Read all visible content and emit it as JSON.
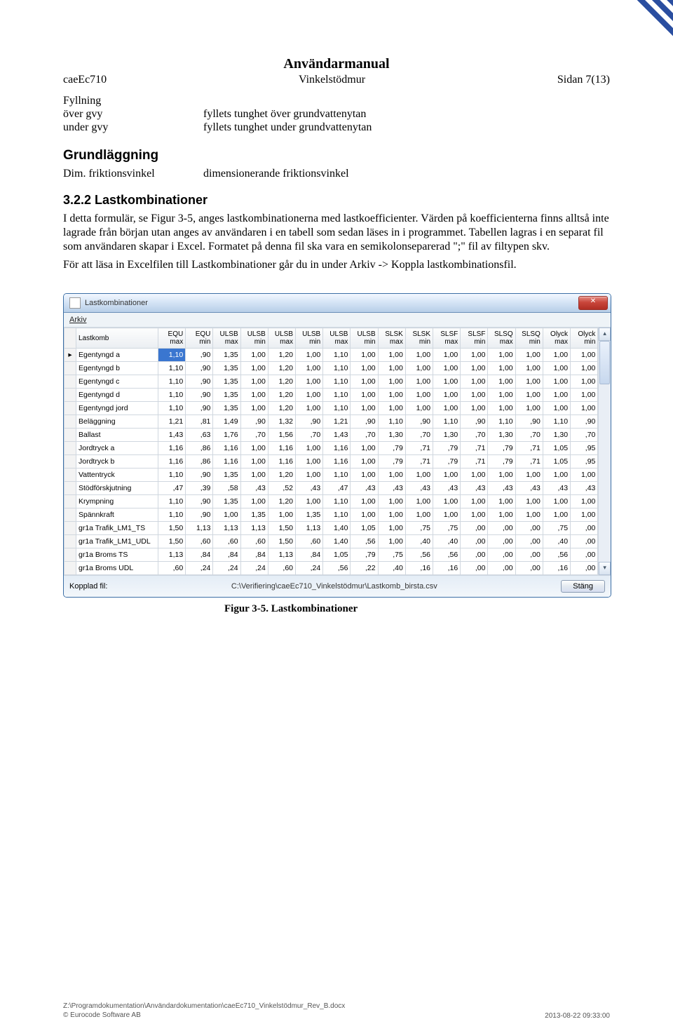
{
  "header": {
    "manual_title": "Användarmanual",
    "left": "caeEc710",
    "center": "Vinkelstödmur",
    "right": "Sidan 7(13)"
  },
  "fyllning": {
    "heading": "Fyllning",
    "rows": [
      {
        "label": "över gvy",
        "desc": "fyllets tunghet över grundvattenytan"
      },
      {
        "label": "under gvy",
        "desc": "fyllets tunghet under grundvattenytan"
      }
    ]
  },
  "grundlaggning": {
    "heading": "Grundläggning",
    "rows": [
      {
        "label": "Dim. friktionsvinkel",
        "desc": "dimensionerande friktionsvinkel"
      }
    ]
  },
  "section": {
    "num_title": "3.2.2 Lastkombinationer",
    "p1": "I detta formulär, se Figur 3-5, anges lastkombinationerna med lastkoefficienter. Värden på koefficienterna finns alltså inte lagrade från början utan anges av användaren i en tabell som sedan läses in i programmet. Tabellen lagras i en separat fil som användaren skapar i Excel. Formatet på denna fil ska vara en semikolonseparerad \";\" fil av filtypen skv.",
    "p2": "För att läsa in Excelfilen till Lastkombinationer går du in under Arkiv -> Koppla lastkombinationsfil."
  },
  "window": {
    "title": "Lastkombinationer",
    "menu": "Arkiv",
    "footer_label": "Kopplad fil:",
    "footer_path": "C:\\Verifiering\\caeEc710_Vinkelstödmur\\Lastkomb_birsta.csv",
    "close_button": "Stäng",
    "columns": [
      {
        "t1": "Lastkomb",
        "t2": ""
      },
      {
        "t1": "EQU",
        "t2": "max"
      },
      {
        "t1": "EQU",
        "t2": "min"
      },
      {
        "t1": "ULSB",
        "t2": "max"
      },
      {
        "t1": "ULSB",
        "t2": "min"
      },
      {
        "t1": "ULSB",
        "t2": "max"
      },
      {
        "t1": "ULSB",
        "t2": "min"
      },
      {
        "t1": "ULSB",
        "t2": "max"
      },
      {
        "t1": "ULSB",
        "t2": "min"
      },
      {
        "t1": "SLSK",
        "t2": "max"
      },
      {
        "t1": "SLSK",
        "t2": "min"
      },
      {
        "t1": "SLSF",
        "t2": "max"
      },
      {
        "t1": "SLSF",
        "t2": "min"
      },
      {
        "t1": "SLSQ",
        "t2": "max"
      },
      {
        "t1": "SLSQ",
        "t2": "min"
      },
      {
        "t1": "Olyck",
        "t2": "max"
      },
      {
        "t1": "Olyck",
        "t2": "min"
      }
    ],
    "rows": [
      {
        "name": "Egentyngd a",
        "v": [
          "1,10",
          ",90",
          "1,35",
          "1,00",
          "1,20",
          "1,00",
          "1,10",
          "1,00",
          "1,00",
          "1,00",
          "1,00",
          "1,00",
          "1,00",
          "1,00",
          "1,00",
          "1,00"
        ],
        "sel": true
      },
      {
        "name": "Egentyngd b",
        "v": [
          "1,10",
          ",90",
          "1,35",
          "1,00",
          "1,20",
          "1,00",
          "1,10",
          "1,00",
          "1,00",
          "1,00",
          "1,00",
          "1,00",
          "1,00",
          "1,00",
          "1,00",
          "1,00"
        ]
      },
      {
        "name": "Egentyngd c",
        "v": [
          "1,10",
          ",90",
          "1,35",
          "1,00",
          "1,20",
          "1,00",
          "1,10",
          "1,00",
          "1,00",
          "1,00",
          "1,00",
          "1,00",
          "1,00",
          "1,00",
          "1,00",
          "1,00"
        ]
      },
      {
        "name": "Egentyngd d",
        "v": [
          "1,10",
          ",90",
          "1,35",
          "1,00",
          "1,20",
          "1,00",
          "1,10",
          "1,00",
          "1,00",
          "1,00",
          "1,00",
          "1,00",
          "1,00",
          "1,00",
          "1,00",
          "1,00"
        ]
      },
      {
        "name": "Egentyngd jord",
        "v": [
          "1,10",
          ",90",
          "1,35",
          "1,00",
          "1,20",
          "1,00",
          "1,10",
          "1,00",
          "1,00",
          "1,00",
          "1,00",
          "1,00",
          "1,00",
          "1,00",
          "1,00",
          "1,00"
        ]
      },
      {
        "name": "Beläggning",
        "v": [
          "1,21",
          ",81",
          "1,49",
          ",90",
          "1,32",
          ",90",
          "1,21",
          ",90",
          "1,10",
          ",90",
          "1,10",
          ",90",
          "1,10",
          ",90",
          "1,10",
          ",90"
        ]
      },
      {
        "name": "Ballast",
        "v": [
          "1,43",
          ",63",
          "1,76",
          ",70",
          "1,56",
          ",70",
          "1,43",
          ",70",
          "1,30",
          ",70",
          "1,30",
          ",70",
          "1,30",
          ",70",
          "1,30",
          ",70"
        ]
      },
      {
        "name": "Jordtryck a",
        "v": [
          "1,16",
          ",86",
          "1,16",
          "1,00",
          "1,16",
          "1,00",
          "1,16",
          "1,00",
          ",79",
          ",71",
          ",79",
          ",71",
          ",79",
          ",71",
          "1,05",
          ",95"
        ]
      },
      {
        "name": "Jordtryck b",
        "v": [
          "1,16",
          ",86",
          "1,16",
          "1,00",
          "1,16",
          "1,00",
          "1,16",
          "1,00",
          ",79",
          ",71",
          ",79",
          ",71",
          ",79",
          ",71",
          "1,05",
          ",95"
        ]
      },
      {
        "name": "Vattentryck",
        "v": [
          "1,10",
          ",90",
          "1,35",
          "1,00",
          "1,20",
          "1,00",
          "1,10",
          "1,00",
          "1,00",
          "1,00",
          "1,00",
          "1,00",
          "1,00",
          "1,00",
          "1,00",
          "1,00"
        ]
      },
      {
        "name": "Stödförskjutning",
        "v": [
          ",47",
          ",39",
          ",58",
          ",43",
          ",52",
          ",43",
          ",47",
          ",43",
          ",43",
          ",43",
          ",43",
          ",43",
          ",43",
          ",43",
          ",43",
          ",43"
        ]
      },
      {
        "name": "Krympning",
        "v": [
          "1,10",
          ",90",
          "1,35",
          "1,00",
          "1,20",
          "1,00",
          "1,10",
          "1,00",
          "1,00",
          "1,00",
          "1,00",
          "1,00",
          "1,00",
          "1,00",
          "1,00",
          "1,00"
        ]
      },
      {
        "name": "Spännkraft",
        "v": [
          "1,10",
          ",90",
          "1,00",
          "1,35",
          "1,00",
          "1,35",
          "1,10",
          "1,00",
          "1,00",
          "1,00",
          "1,00",
          "1,00",
          "1,00",
          "1,00",
          "1,00",
          "1,00"
        ]
      },
      {
        "name": "gr1a Trafik_LM1_TS",
        "v": [
          "1,50",
          "1,13",
          "1,13",
          "1,13",
          "1,50",
          "1,13",
          "1,40",
          "1,05",
          "1,00",
          ",75",
          ",75",
          ",00",
          ",00",
          ",00",
          ",75",
          ",00"
        ]
      },
      {
        "name": "gr1a Trafik_LM1_UDL",
        "v": [
          "1,50",
          ",60",
          ",60",
          ",60",
          "1,50",
          ",60",
          "1,40",
          ",56",
          "1,00",
          ",40",
          ",40",
          ",00",
          ",00",
          ",00",
          ",40",
          ",00"
        ]
      },
      {
        "name": "gr1a Broms TS",
        "v": [
          "1,13",
          ",84",
          ",84",
          ",84",
          "1,13",
          ",84",
          "1,05",
          ",79",
          ",75",
          ",56",
          ",56",
          ",00",
          ",00",
          ",00",
          ",56",
          ",00"
        ]
      },
      {
        "name": "gr1a Broms UDL",
        "v": [
          ",60",
          ",24",
          ",24",
          ",24",
          ",60",
          ",24",
          ",56",
          ",22",
          ",40",
          ",16",
          ",16",
          ",00",
          ",00",
          ",00",
          ",16",
          ",00"
        ]
      }
    ]
  },
  "figure_caption": "Figur 3-5. Lastkombinationer",
  "footer": {
    "path": "Z:\\Programdokumentation\\Användardokumentation\\caeEc710_Vinkelstödmur_Rev_B.docx",
    "copyright": "© Eurocode Software AB",
    "timestamp": "2013-08-22 09:33:00"
  }
}
